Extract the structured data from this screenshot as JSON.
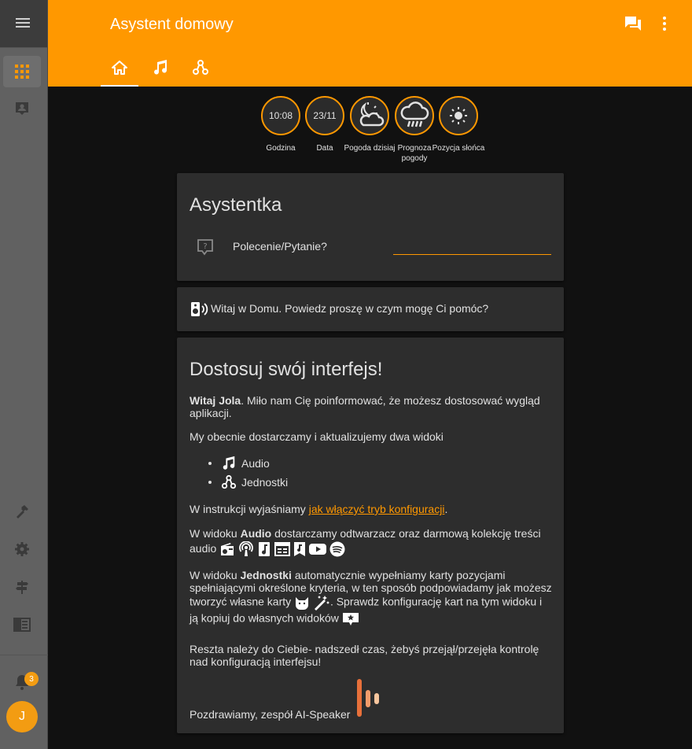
{
  "sidebar": {
    "notification_count": "3",
    "user_initial": "J"
  },
  "header": {
    "title": "Asystent domowy"
  },
  "badges": [
    {
      "value": "10:08",
      "label": "Godzina"
    },
    {
      "value": "23/11",
      "label": "Data"
    },
    {
      "value": "",
      "label": "Pogoda dzisiaj"
    },
    {
      "value": "",
      "label": "Prognoza pogody"
    },
    {
      "value": "",
      "label": "Pozycja słońca"
    }
  ],
  "assistant_card": {
    "title": "Asystentka",
    "input_label": "Polecenie/Pytanie?",
    "input_value": ""
  },
  "welcome_card": {
    "message": "Witaj w Domu. Powiedz proszę w czym mogę Ci pomóc?"
  },
  "customize_card": {
    "title": "Dostosuj swój interfejs!",
    "greeting_bold": "Witaj Jola",
    "greeting_rest": ". Miło nam Cię poinformować, że możesz dostosować wygląd aplikacji.",
    "widgets_intro": "My obecnie dostarczamy i aktualizujemy dwa widoki",
    "widget_audio": "Audio",
    "widget_units": "Jednostki",
    "instructions_prefix": "W instrukcji wyjaśniamy ",
    "instructions_link": "jak włączyć tryb konfiguracji",
    "instructions_suffix": ".",
    "audio_prefix": "W widoku ",
    "audio_bold": "Audio",
    "audio_rest": " dostarczamy odtwarzacz oraz darmową kolekcję treści audio",
    "units_prefix": "W widoku ",
    "units_bold": "Jednostki",
    "units_rest": " automatycznie wypełniamy karty pozycjami spełniającymi określone kryteria, w ten sposób podpowiadamy jak możesz tworzyć własne karty",
    "units_rest2": ". Sprawdz konfigurację kart na tym widoku i ją kopiuj do własnych widoków",
    "rest_text": "Reszta należy do Ciebie- nadszedł czas, żebyś przejął/przejęła kontrolę nad konfiguracją interfejsu!",
    "signature": "Pozdrawiamy, zespół AI-Speaker"
  }
}
